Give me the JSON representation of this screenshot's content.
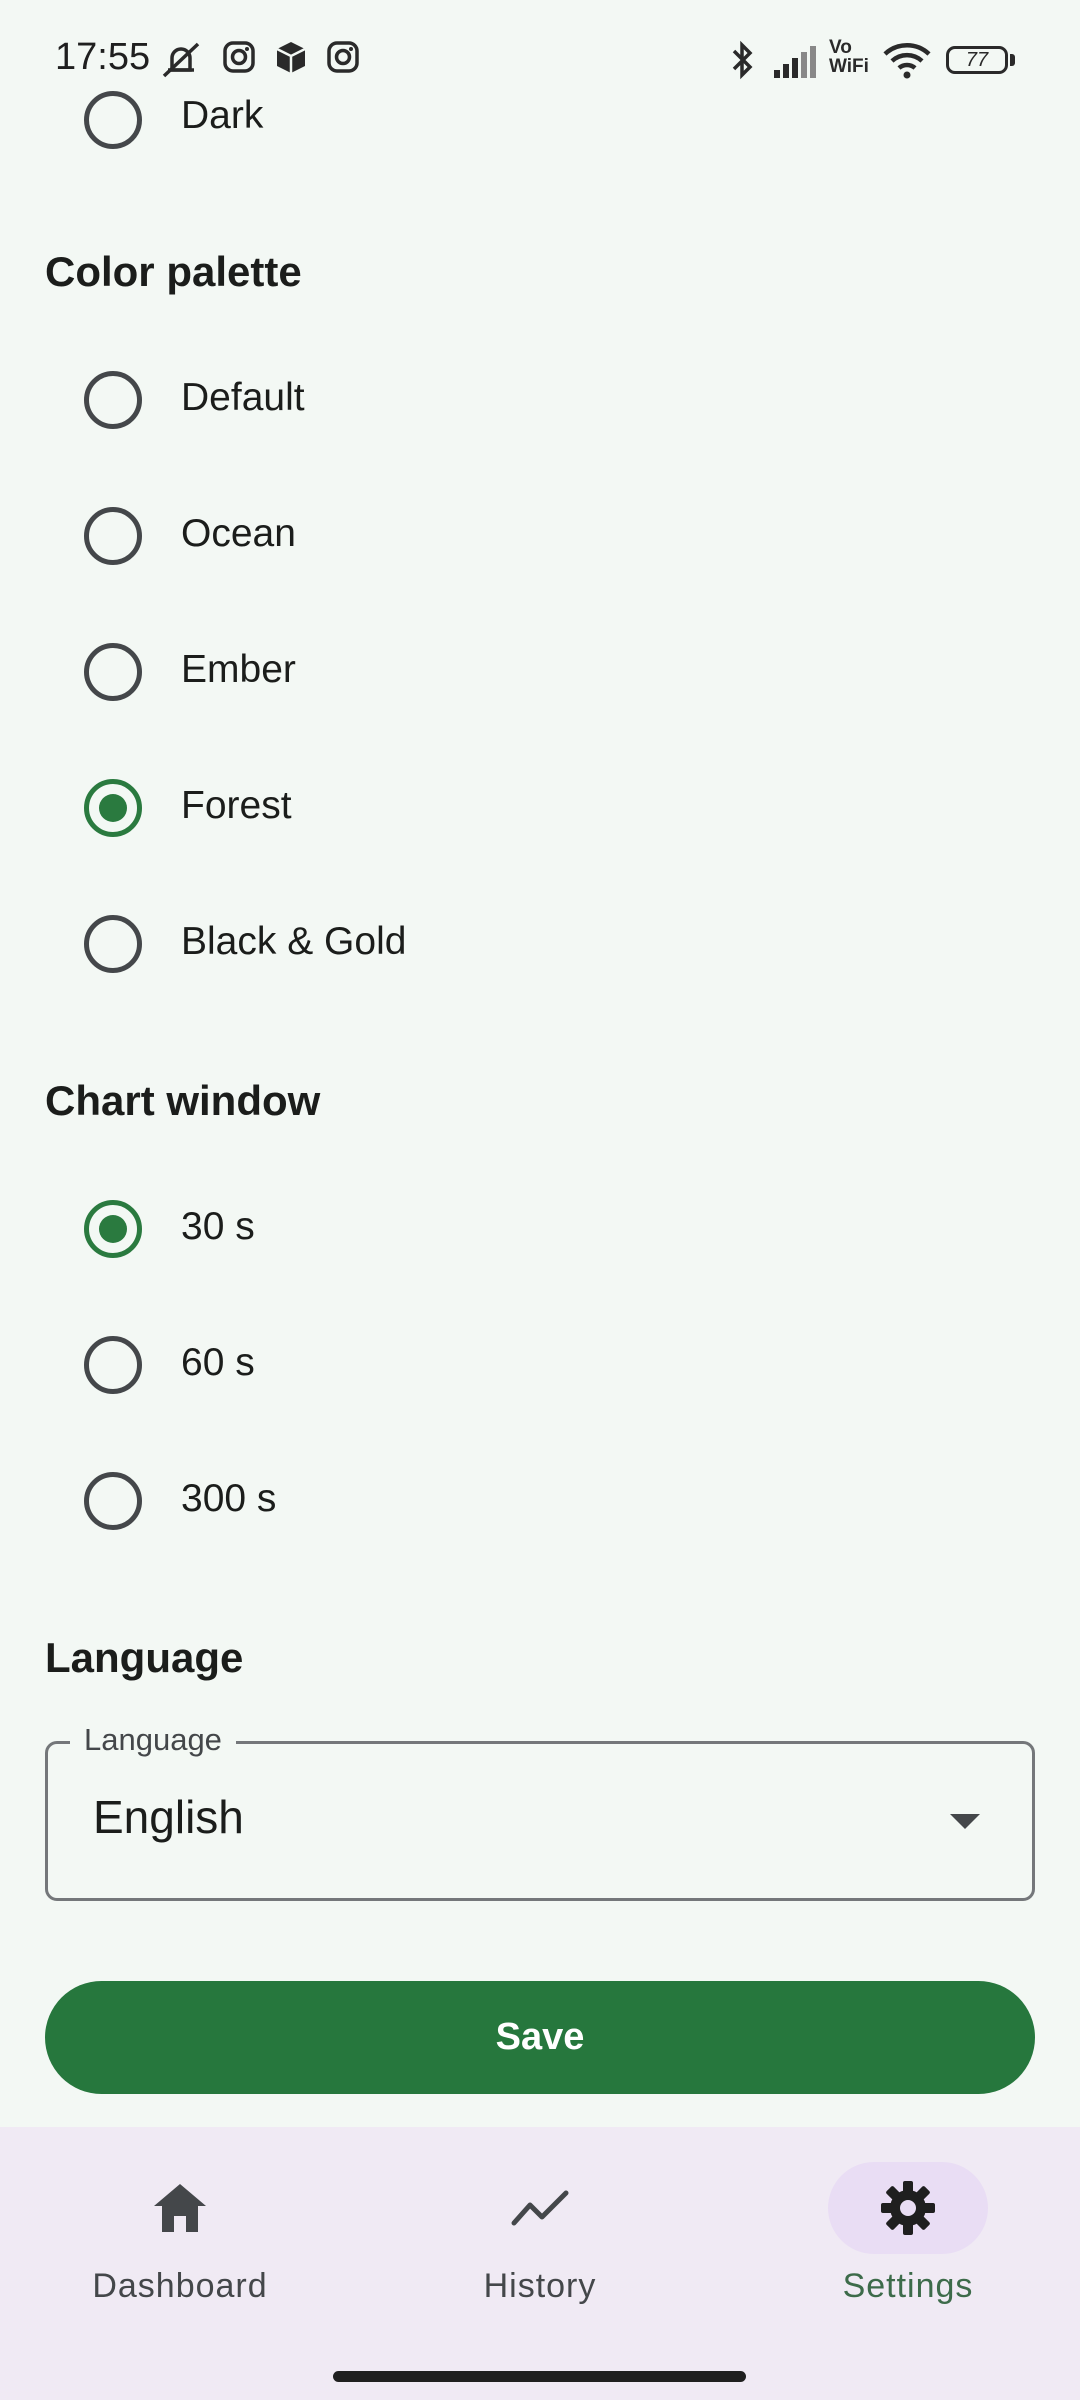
{
  "status_bar": {
    "time": "17:55",
    "battery": "77",
    "vowifi": "Vo\nWiFi"
  },
  "theme_partial": {
    "visible_option": "Dark"
  },
  "color_palette": {
    "title": "Color palette",
    "options": [
      {
        "label": "Default",
        "selected": false
      },
      {
        "label": "Ocean",
        "selected": false
      },
      {
        "label": "Ember",
        "selected": false
      },
      {
        "label": "Forest",
        "selected": true
      },
      {
        "label": "Black & Gold",
        "selected": false
      }
    ]
  },
  "chart_window": {
    "title": "Chart window",
    "options": [
      {
        "label": "30 s",
        "selected": true
      },
      {
        "label": "60 s",
        "selected": false
      },
      {
        "label": "300 s",
        "selected": false
      }
    ]
  },
  "language": {
    "title": "Language",
    "field_label": "Language",
    "value": "English"
  },
  "save_label": "Save",
  "nav": {
    "items": [
      {
        "label": "Dashboard",
        "icon": "home-icon",
        "active": false
      },
      {
        "label": "History",
        "icon": "chart-line-icon",
        "active": false
      },
      {
        "label": "Settings",
        "icon": "gear-icon",
        "active": true
      }
    ]
  },
  "colors": {
    "accent": "#26773d",
    "background": "#f3f8f4",
    "nav_background": "#f0eaf4"
  }
}
